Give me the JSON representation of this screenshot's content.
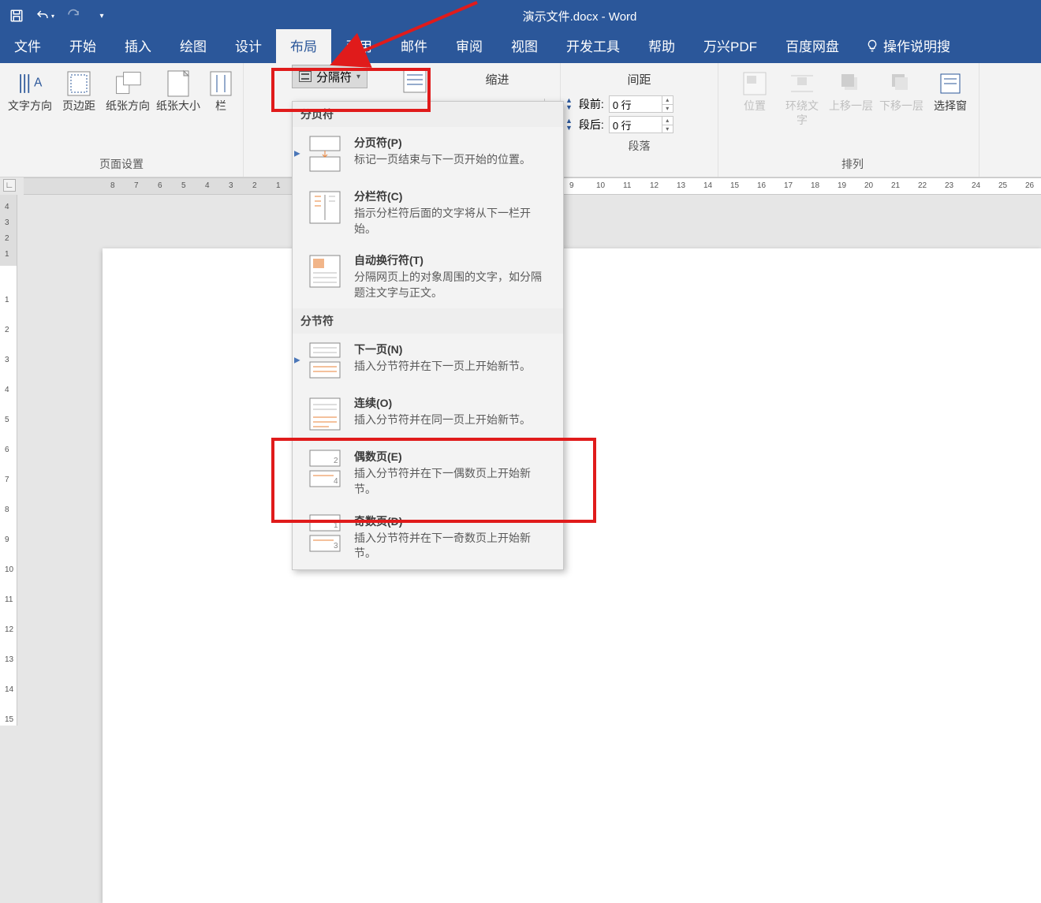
{
  "title": "演示文件.docx  -  Word",
  "tabs": {
    "file": "文件",
    "home": "开始",
    "insert": "插入",
    "draw": "绘图",
    "design": "设计",
    "layout": "布局",
    "references": "引用",
    "mailings": "邮件",
    "review": "审阅",
    "view": "视图",
    "developer": "开发工具",
    "help": "帮助",
    "wanxing": "万兴PDF",
    "baidu": "百度网盘",
    "tellme": "操作说明搜"
  },
  "page_setup": {
    "text_direction": "文字方向",
    "margins": "页边距",
    "orientation": "纸张方向",
    "size": "纸张大小",
    "columns": "栏",
    "group_label": "页面设置"
  },
  "breaks_btn": "分隔符",
  "indent": {
    "header": "缩进"
  },
  "spacing": {
    "header": "间距",
    "before_label": "段前:",
    "before_value": "0 行",
    "after_label": "段后:",
    "after_value": "0 行"
  },
  "paragraph_group": "段落",
  "arrange": {
    "position": "位置",
    "wrap": "环绕文\n字",
    "bring_forward": "上移一层",
    "send_backward": "下移一层",
    "selection_pane": "选择窗",
    "group_label": "排列"
  },
  "dd": {
    "page_breaks_header": "分页符",
    "section_breaks_header": "分节符",
    "page_break": {
      "title": "分页符(P)",
      "desc": "标记一页结束与下一页开始的位置。"
    },
    "column_break": {
      "title": "分栏符(C)",
      "desc": "指示分栏符后面的文字将从下一栏开始。"
    },
    "text_wrapping": {
      "title": "自动换行符(T)",
      "desc": "分隔网页上的对象周围的文字，如分隔题注文字与正文。"
    },
    "next_page": {
      "title": "下一页(N)",
      "desc": "插入分节符并在下一页上开始新节。"
    },
    "continuous": {
      "title": "连续(O)",
      "desc": "插入分节符并在同一页上开始新节。"
    },
    "even_page": {
      "title": "偶数页(E)",
      "desc": "插入分节符并在下一偶数页上开始新节。"
    },
    "odd_page": {
      "title": "奇数页(D)",
      "desc": "插入分节符并在下一奇数页上开始新节。"
    }
  }
}
